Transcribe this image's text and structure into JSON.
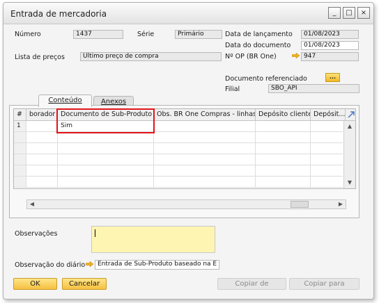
{
  "window": {
    "title": "Entrada de mercadoria"
  },
  "window_controls": {
    "minimize": "_",
    "maximize": "□",
    "close": "×"
  },
  "header": {
    "numero_label": "Número",
    "numero_value": "1437",
    "serie_label": "Série",
    "serie_value": "Primário",
    "lista_label": "Lista de preços",
    "lista_value": "Último preço de compra",
    "data_lanc_label": "Data de lançamento",
    "data_lanc_value": "01/08/2023",
    "data_doc_label": "Data do documento",
    "data_doc_value": "01/08/2023",
    "op_label": "Nº OP (BR One)",
    "op_value": "947",
    "doc_ref_label": "Documento referenciado",
    "doc_ref_button": "...",
    "filial_label": "Filial",
    "filial_value": "SBO_API"
  },
  "tabs": [
    {
      "label": "Conteúdo",
      "active": true
    },
    {
      "label": "Anexos",
      "active": false
    }
  ],
  "grid": {
    "columns": [
      "#",
      "borador",
      "Documento de Sub-Produto",
      "Obs. BR One Compras - linhas",
      "Depósito cliente",
      "Depósit..."
    ],
    "rows": [
      [
        "1",
        "",
        "Sim",
        "",
        "",
        ""
      ]
    ],
    "empty_rows": 5
  },
  "footer": {
    "observacoes_label": "Observações",
    "observacoes_value": "",
    "obs_diario_label": "Observação do diário",
    "obs_diario_value": "Entrada de Sub-Produto baseado na E",
    "ok_label": "OK",
    "cancelar_label": "Cancelar",
    "copiar_de_label": "Copiar de",
    "copiar_para_label": "Copiar para"
  },
  "colors": {
    "accent": "#f5c040",
    "highlight": "#e0141a",
    "link_arrow": "#f0b020"
  }
}
